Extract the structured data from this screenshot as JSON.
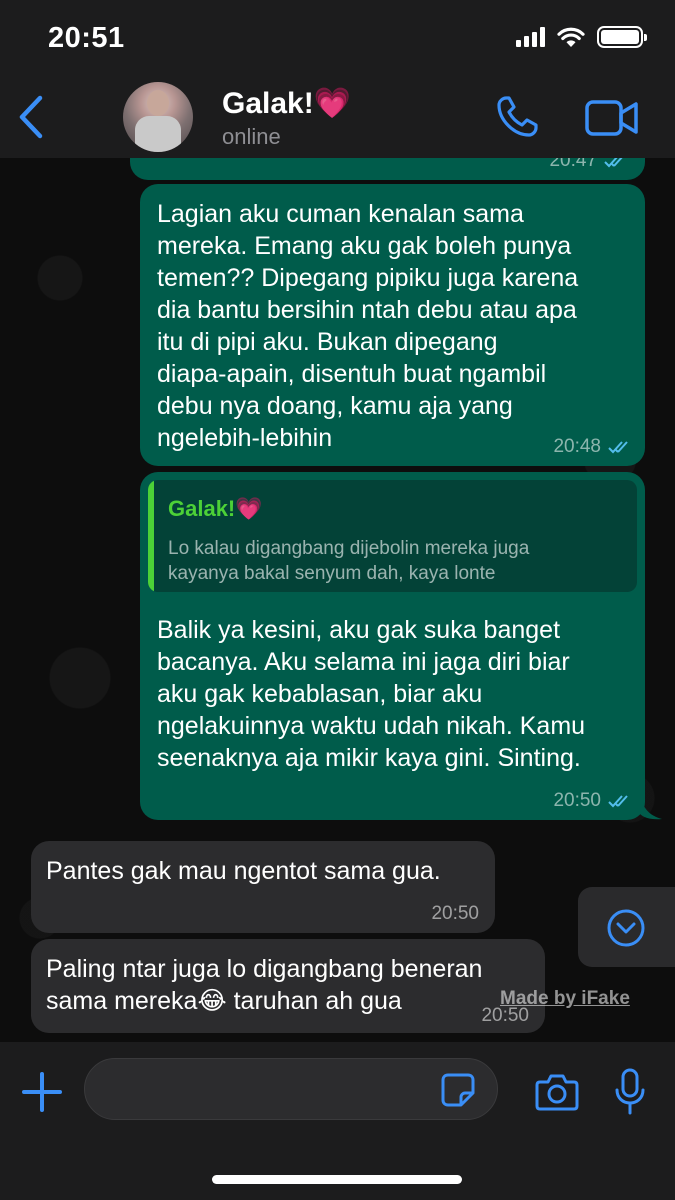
{
  "status_bar": {
    "time": "20:51"
  },
  "header": {
    "contact_name": "Galak!💗",
    "contact_status": "online",
    "accent_color": "#3a8ef6"
  },
  "messages": [
    {
      "direction": "outgoing",
      "text": "",
      "time": "20:47",
      "read": true
    },
    {
      "direction": "outgoing",
      "text": "Lagian aku cuman kenalan sama\nmereka. Emang aku gak boleh punya\ntemen?? Dipegang pipiku juga karena\ndia bantu bersihin ntah debu atau apa\nitu di pipi aku. Bukan dipegang\ndiapa-apain, disentuh buat ngambil\ndebu nya doang, kamu aja yang\nngelebih-lebihin",
      "time": "20:48",
      "read": true
    },
    {
      "direction": "outgoing",
      "quote": {
        "name": "Galak!💗",
        "text": "Lo kalau digangbang dijebolin mereka juga\nkayanya bakal senyum dah, kaya lonte"
      },
      "text": "Balik ya kesini, aku gak suka banget\nbacanya. Aku selama ini jaga diri biar\naku gak kebablasan, biar aku\nngelakuinnya waktu udah nikah. Kamu\nseenaknya aja mikir kaya gini. Sinting.",
      "time": "20:50",
      "read": true
    },
    {
      "direction": "incoming",
      "text": "Pantes gak mau ngentot sama gua.",
      "time": "20:50"
    },
    {
      "direction": "incoming",
      "text": "Paling ntar juga lo digangbang beneran\nsama mereka😂 taruhan ah gua",
      "time": "20:50"
    }
  ],
  "watermark": "Made by iFake",
  "colors": {
    "outgoing_bubble": "#005c4b",
    "incoming_bubble": "#2c2c2e",
    "quote_accent": "#4cd137"
  }
}
